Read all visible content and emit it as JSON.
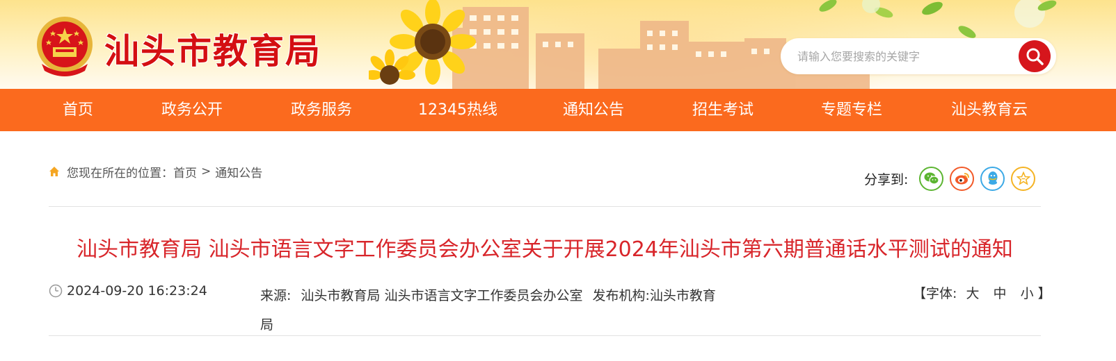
{
  "site": {
    "name": "汕头市教育局"
  },
  "search": {
    "placeholder": "请输入您要搜索的关键字"
  },
  "nav": [
    "首页",
    "政务公开",
    "政务服务",
    "12345热线",
    "通知公告",
    "招生考试",
    "专题专栏",
    "汕头教育云"
  ],
  "breadcrumb": {
    "prefix": "您现在所在的位置：",
    "home": "首页",
    "separator": ">",
    "current": "通知公告"
  },
  "share": {
    "label": "分享到:",
    "targets": [
      "wechat",
      "weibo",
      "qq",
      "favorite"
    ],
    "colors": {
      "wechat": "#5cb531",
      "weibo": "#f25a29",
      "qq": "#3ba9e6",
      "favorite": "#f5b323"
    }
  },
  "article": {
    "title": "汕头市教育局 汕头市语言文字工作委员会办公室关于开展2024年汕头市第六期普通话水平测试的通知",
    "date": "2024-09-20 16:23:24",
    "source_label": "来源:",
    "source": "汕头市教育局 汕头市语言文字工作委员会办公室",
    "publisher_label": "发布机构:",
    "publisher": "汕头市教育局"
  },
  "font_control": {
    "open": "【字体:",
    "large": "大",
    "medium": "中",
    "small": "小",
    "close": "】"
  },
  "colors": {
    "nav_bg": "#fb6a1e",
    "title": "#d8252a",
    "brand_red": "#d40f12"
  }
}
